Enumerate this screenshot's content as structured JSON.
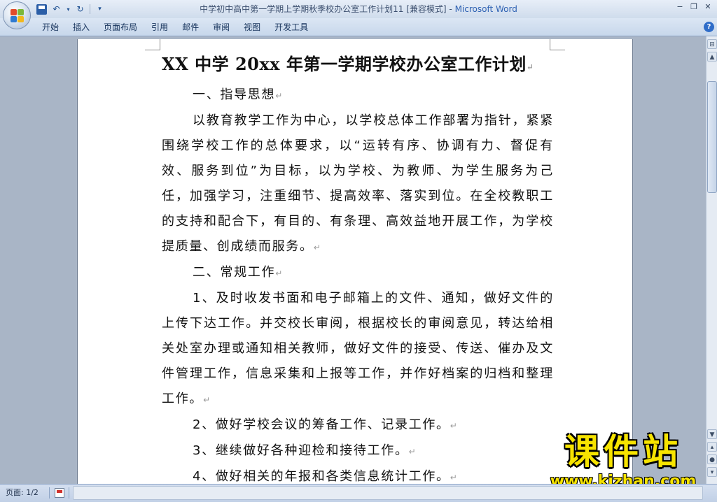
{
  "window": {
    "title": "中学初中高中第一学期上学期秋季校办公室工作计划11 [兼容模式] - ",
    "app_name": "Microsoft Word"
  },
  "quick_access": {
    "icons": [
      "save-icon",
      "undo-icon",
      "redo-icon",
      "customize-icon"
    ]
  },
  "ribbon": {
    "tabs": [
      "开始",
      "插入",
      "页面布局",
      "引用",
      "邮件",
      "审阅",
      "视图",
      "开发工具"
    ]
  },
  "document": {
    "title": "XX 中学 20xx 年第一学期学校办公室工作计划",
    "paragraphs": [
      "一、指导思想",
      "以教育教学工作为中心，以学校总体工作部署为指针，紧紧围绕学校工作的总体要求，以“运转有序、协调有力、督促有效、服务到位”为目标，以为学校、为教师、为学生服务为己任，加强学习，注重细节、提高效率、落实到位。在全校教职工的支持和配合下，有目的、有条理、高效益地开展工作，为学校提质量、创成绩而服务。",
      "二、常规工作",
      "1、及时收发书面和电子邮箱上的文件、通知，做好文件的上传下达工作。并交校长审阅，根据校长的审阅意见，转达给相关处室办理或通知相关教师，做好文件的接受、传送、催办及文件管理工作，信息采集和上报等工作，并作好档案的归档和整理工作。",
      "2、做好学校会议的筹备工作、记录工作。",
      "3、继续做好各种迎检和接待工作。",
      "4、做好相关的年报和各类信息统计工作。"
    ],
    "paragraph_mark": "↵"
  },
  "watermark": {
    "name": "课件站",
    "url": "www.kjzhan.com"
  },
  "statusbar": {
    "page_info": "页面: 1/2"
  }
}
